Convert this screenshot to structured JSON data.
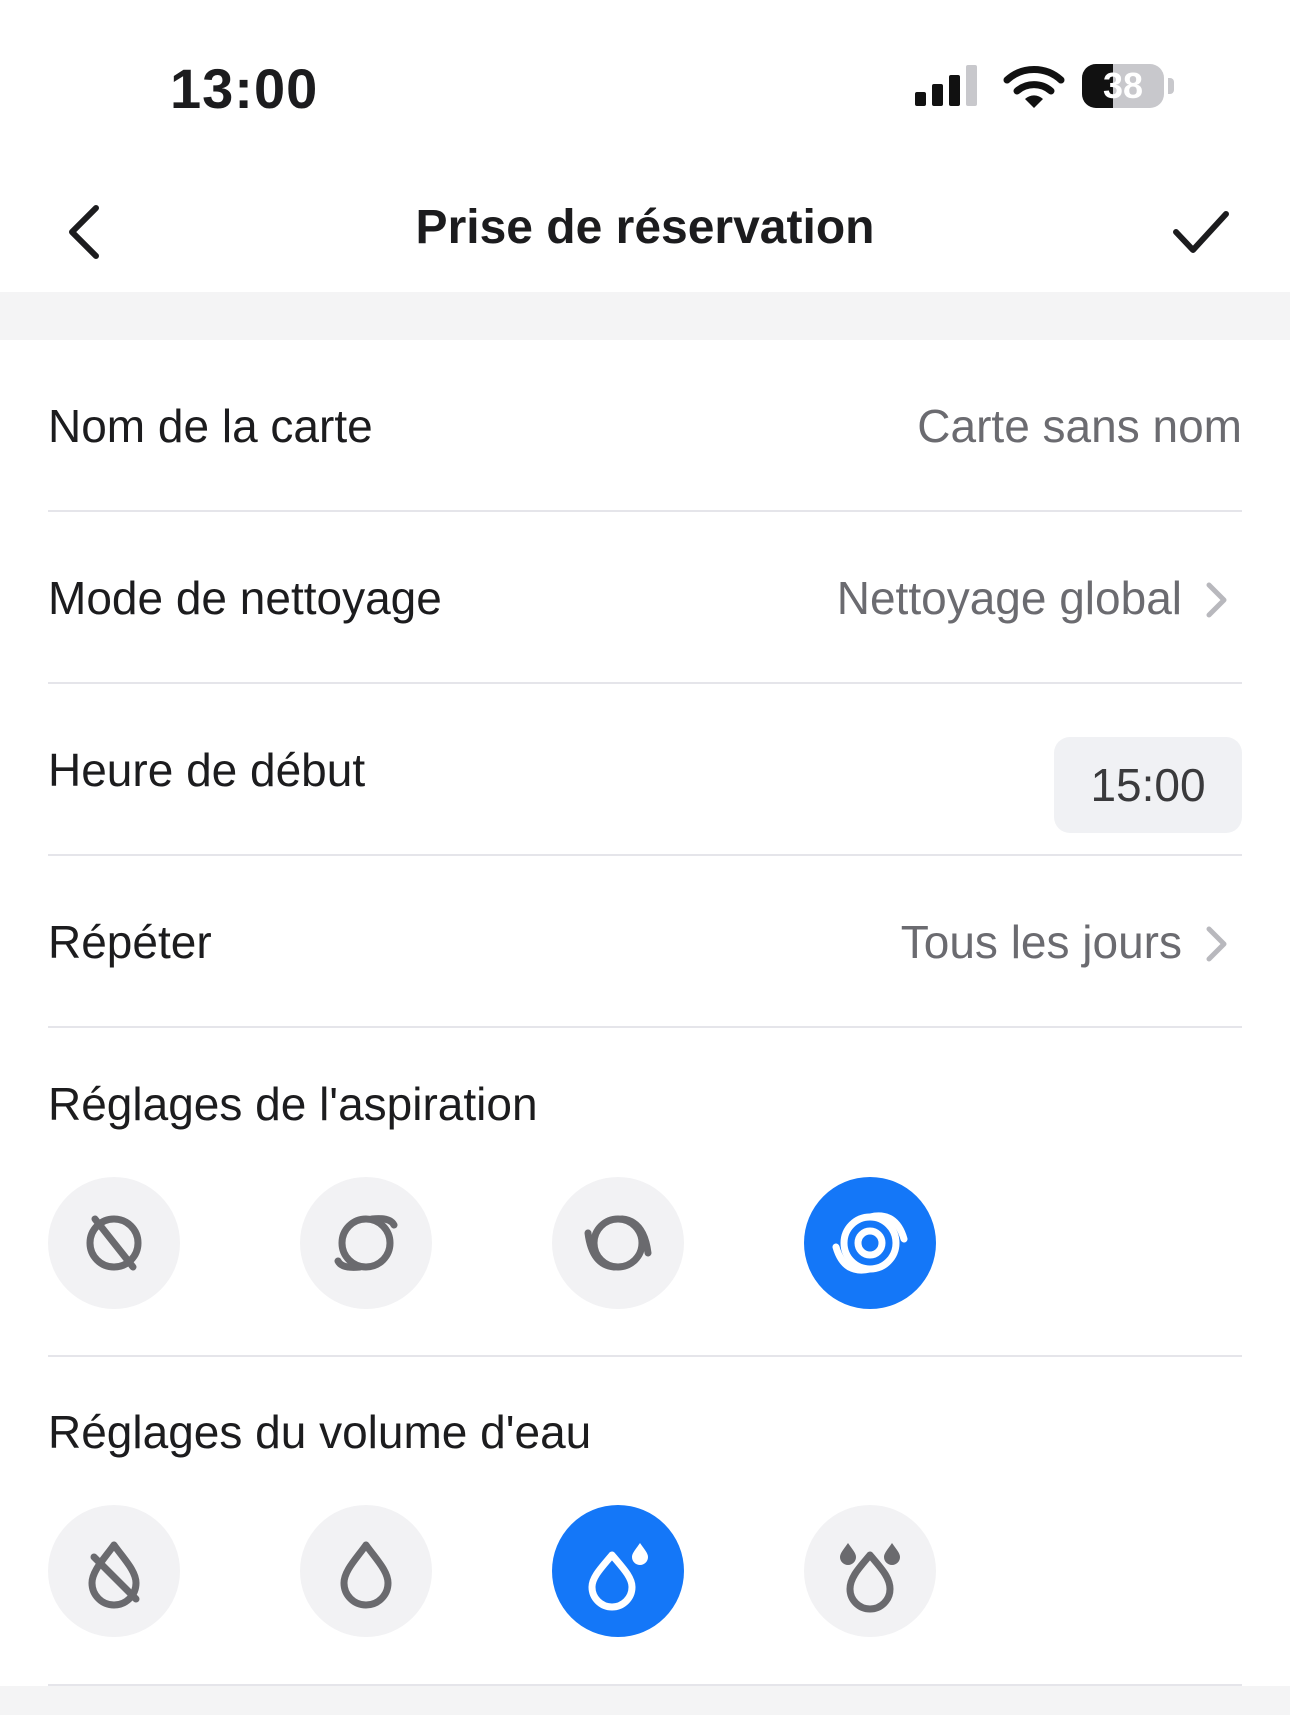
{
  "status_bar": {
    "time": "13:00",
    "battery": "38",
    "battery_level": 0.38
  },
  "nav": {
    "title": "Prise de réservation"
  },
  "rows": {
    "map_name": {
      "label": "Nom de la carte",
      "value": "Carte sans nom"
    },
    "clean_mode": {
      "label": "Mode de nettoyage",
      "value": "Nettoyage global"
    },
    "start_time": {
      "label": "Heure de début",
      "value": "15:00"
    },
    "repeat": {
      "label": "Répéter",
      "value": "Tous les jours"
    }
  },
  "suction": {
    "title": "Réglages de l'aspiration",
    "options": [
      "suction-off-icon",
      "suction-quiet-icon",
      "suction-standard-icon",
      "suction-max-icon"
    ],
    "selected_index": 3
  },
  "water": {
    "title": "Réglages du volume d'eau",
    "options": [
      "water-off-icon",
      "water-low-icon",
      "water-medium-icon",
      "water-high-icon"
    ],
    "selected_index": 2
  },
  "colors": {
    "accent": "#1477f8",
    "icon_gray": "#6a6a6e",
    "option_bg": "#f2f2f4"
  }
}
